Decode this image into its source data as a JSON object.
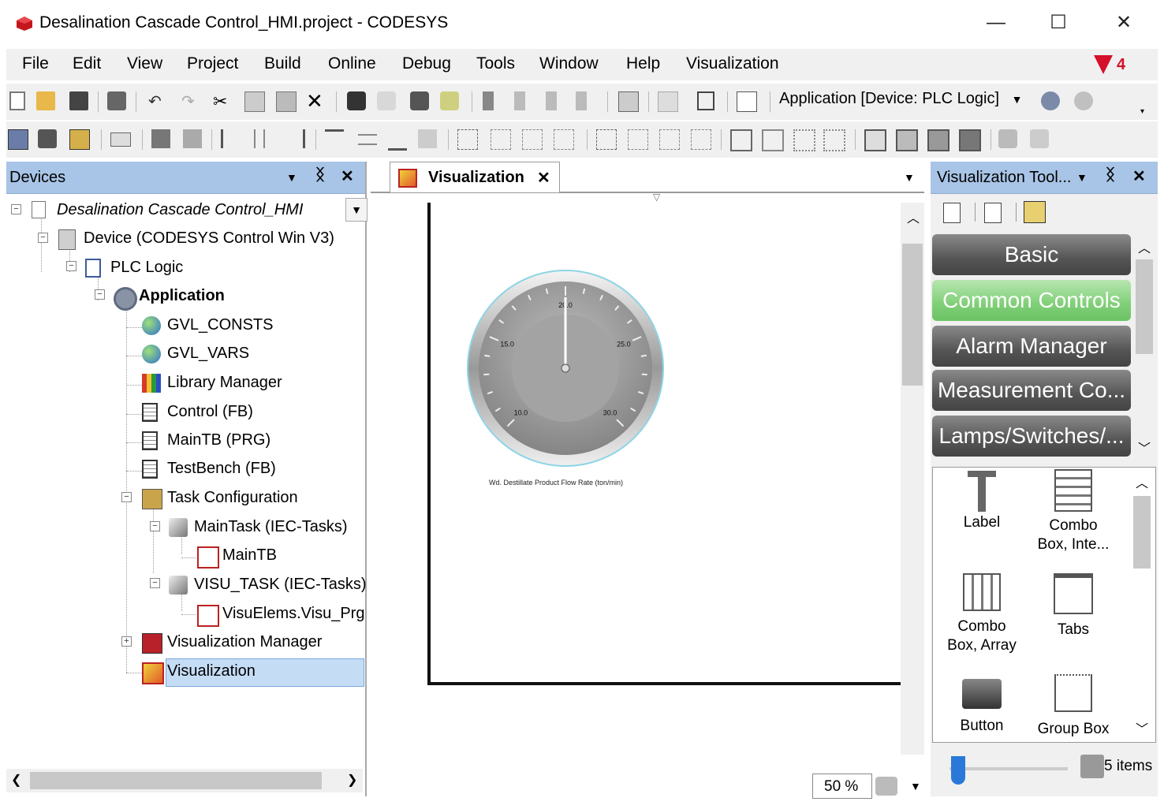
{
  "window": {
    "title": "Desalination Cascade Control_HMI.project - CODESYS",
    "controls": {
      "minimize": "—",
      "maximize": "☐",
      "close": "✕"
    }
  },
  "menu": [
    "File",
    "Edit",
    "View",
    "Project",
    "Build",
    "Online",
    "Debug",
    "Tools",
    "Window",
    "Help",
    "Visualization"
  ],
  "alert": {
    "count": "4",
    "color": "#d4102a"
  },
  "toolbar": {
    "application_selector": "Application [Device: PLC Logic]"
  },
  "devices_panel": {
    "title": "Devices",
    "tree": [
      {
        "label": "Desalination Cascade Control_HMI",
        "icon": "project-icon"
      },
      {
        "label": "Device (CODESYS Control Win V3)",
        "icon": "device-icon"
      },
      {
        "label": "PLC Logic",
        "icon": "plc-logic-icon"
      },
      {
        "label": "Application",
        "icon": "application-gear-icon"
      },
      {
        "label": "GVL_CONSTS",
        "icon": "globe-icon"
      },
      {
        "label": "GVL_VARS",
        "icon": "globe-icon"
      },
      {
        "label": "Library Manager",
        "icon": "library-icon"
      },
      {
        "label": "Control (FB)",
        "icon": "pou-icon"
      },
      {
        "label": "MainTB (PRG)",
        "icon": "pou-icon"
      },
      {
        "label": "TestBench (FB)",
        "icon": "pou-icon"
      },
      {
        "label": "Task Configuration",
        "icon": "task-config-icon"
      },
      {
        "label": "MainTask (IEC-Tasks)",
        "icon": "task-icon"
      },
      {
        "label": "MainTB",
        "icon": "visu-call-icon"
      },
      {
        "label": "VISU_TASK (IEC-Tasks)",
        "icon": "task-icon"
      },
      {
        "label": "VisuElems.Visu_Prg",
        "icon": "visu-call-icon"
      },
      {
        "label": "Visualization Manager",
        "icon": "visu-manager-icon"
      },
      {
        "label": "Visualization",
        "icon": "visualization-icon"
      }
    ]
  },
  "editor": {
    "tab_label": "Visualization",
    "gauge": {
      "ticks": [
        "10.0",
        "15.0",
        "20.0",
        "25.0",
        "30.0"
      ],
      "value": 20.0,
      "caption": "Wd. Destillate Product Flow Rate (ton/min)"
    },
    "zoom": "50 %"
  },
  "toolbox": {
    "title": "Visualization Tool...",
    "categories": [
      {
        "label": "Basic",
        "active": false
      },
      {
        "label": "Common Controls",
        "active": true
      },
      {
        "label": "Alarm Manager",
        "active": false
      },
      {
        "label": "Measurement Co...",
        "active": false
      },
      {
        "label": "Lamps/Switches/...",
        "active": false
      }
    ],
    "items": [
      {
        "line1": "Label",
        "line2": ""
      },
      {
        "line1": "Combo",
        "line2": "Box, Inte..."
      },
      {
        "line1": "Combo",
        "line2": "Box, Array"
      },
      {
        "line1": "Tabs",
        "line2": ""
      },
      {
        "line1": "Button",
        "line2": ""
      },
      {
        "line1": "Group Box",
        "line2": ""
      }
    ],
    "items_count": "5 items"
  }
}
